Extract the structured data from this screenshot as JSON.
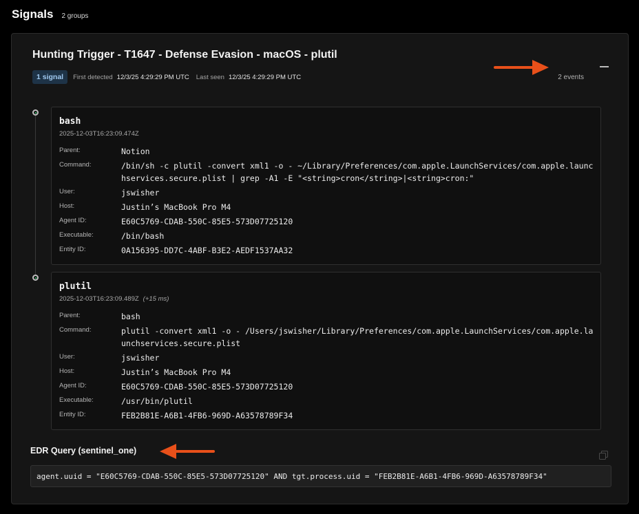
{
  "header": {
    "title": "Signals",
    "group_count": "2 groups"
  },
  "signal": {
    "title": "Hunting Trigger - T1647 - Defense Evasion - macOS - plutil",
    "badge": "1 signal",
    "first_detected_label": "First detected",
    "first_detected": "12/3/25 4:29:29 PM UTC",
    "last_seen_label": "Last seen",
    "last_seen": "12/3/25 4:29:29 PM UTC",
    "events": "2 events"
  },
  "labels": {
    "parent": "Parent:",
    "command": "Command:",
    "user": "User:",
    "host": "Host:",
    "agent_id": "Agent ID:",
    "executable": "Executable:",
    "entity_id": "Entity ID:"
  },
  "processes": [
    {
      "name": "bash",
      "timestamp": "2025-12-03T16:23:09.474Z",
      "delta": "",
      "parent": "Notion",
      "command": "/bin/sh -c plutil -convert xml1 -o - ~/Library/Preferences/com.apple.LaunchServices/com.apple.launchservices.secure.plist | grep -A1 -E \"<string>cron</string>|<string>cron:\"",
      "user": "jswisher",
      "host": "Justin’s MacBook Pro M4",
      "agent_id": "E60C5769-CDAB-550C-85E5-573D07725120",
      "executable": "/bin/bash",
      "entity_id": "0A156395-DD7C-4ABF-B3E2-AEDF1537AA32"
    },
    {
      "name": "plutil",
      "timestamp": "2025-12-03T16:23:09.489Z",
      "delta": "(+15 ms)",
      "parent": "bash",
      "command": "plutil -convert xml1 -o - /Users/jswisher/Library/Preferences/com.apple.LaunchServices/com.apple.launchservices.secure.plist",
      "user": "jswisher",
      "host": "Justin’s MacBook Pro M4",
      "agent_id": "E60C5769-CDAB-550C-85E5-573D07725120",
      "executable": "/usr/bin/plutil",
      "entity_id": "FEB2B81E-A6B1-4FB6-969D-A63578789F34"
    }
  ],
  "edr": {
    "label": "EDR Query (sentinel_one)",
    "query": "agent.uuid = \"E60C5769-CDAB-550C-85E5-573D07725120\" AND tgt.process.uid = \"FEB2B81E-A6B1-4FB6-969D-A63578789F34\""
  },
  "colors": {
    "accent_arrow": "#e8501a",
    "badge_bg": "#1e3347",
    "badge_text": "#9fc8ef",
    "status_dot": "#2fd16b"
  },
  "icons": {
    "collapse": "minus-icon",
    "copy": "copy-icon",
    "annotation": "arrow-icon"
  }
}
